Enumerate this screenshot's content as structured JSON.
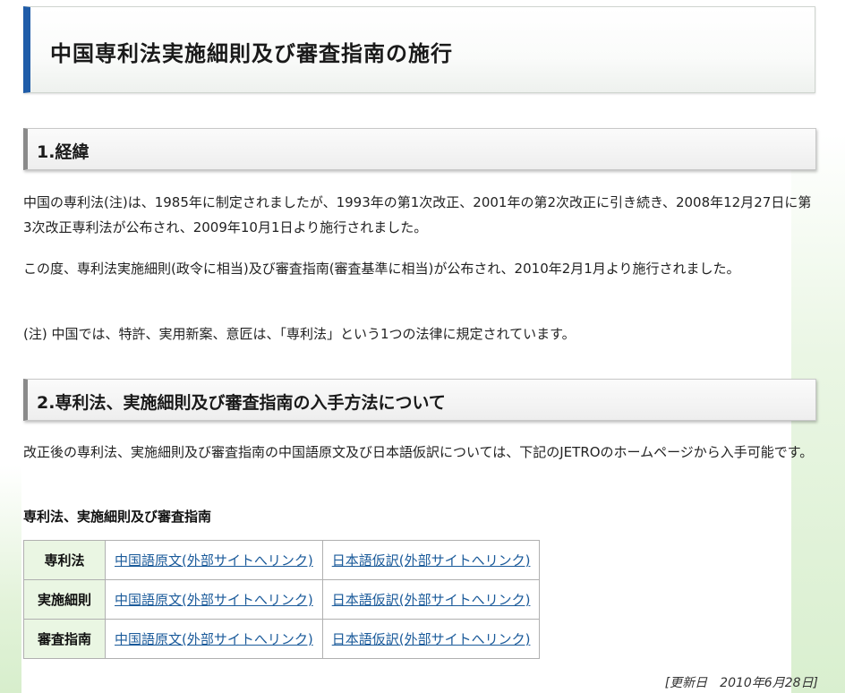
{
  "page_title": "中国専利法実施細則及び審査指南の施行",
  "sections": [
    {
      "heading": "1.経緯",
      "paragraphs": [
        "中国の専利法(注)は、1985年に制定されましたが、1993年の第1次改正、2001年の第2次改正に引き続き、2008年12月27日に第3次改正専利法が公布され、2009年10月1日より施行されました。",
        "この度、専利法実施細則(政令に相当)及び審査指南(審査基準に相当)が公布され、2010年2月1月より施行されました。",
        "(注) 中国では、特許、実用新案、意匠は、「専利法」という1つの法律に規定されています。"
      ]
    },
    {
      "heading": "2.専利法、実施細則及び審査指南の入手方法について",
      "paragraphs": [
        "改正後の専利法、実施細則及び審査指南の中国語原文及び日本語仮訳については、下記のJETROのホームページから入手可能です。"
      ],
      "subheading": "専利法、実施細則及び審査指南"
    }
  ],
  "table": {
    "rows": [
      {
        "label": "専利法",
        "chinese": "中国語原文(外部サイトへリンク)",
        "japanese": "日本語仮訳(外部サイトへリンク)"
      },
      {
        "label": "実施細則",
        "chinese": "中国語原文(外部サイトへリンク)",
        "japanese": "日本語仮訳(外部サイトへリンク)"
      },
      {
        "label": "審査指南",
        "chinese": "中国語原文(外部サイトへリンク)",
        "japanese": "日本語仮訳(外部サイトへリンク)"
      }
    ]
  },
  "updated": "[更新日　2010年6月28日]",
  "colors": {
    "title_accent": "#1f5ca8",
    "link": "#1a5a9a",
    "table_header_bg": "#eaf6e3"
  }
}
